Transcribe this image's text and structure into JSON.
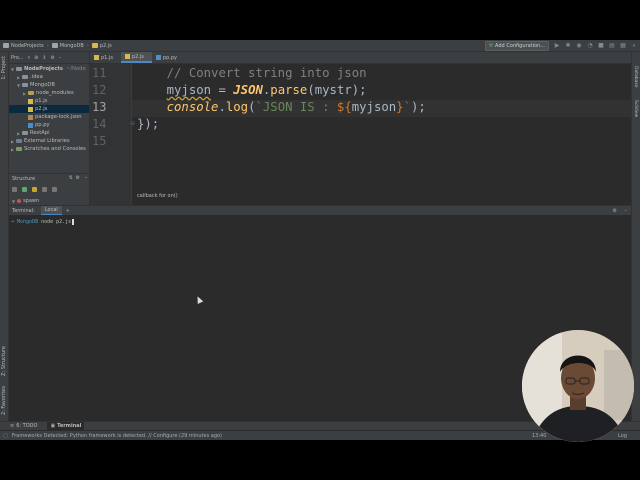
{
  "navbar": {
    "crumbs": [
      "NodeProjects",
      "MongoDB",
      "p2.js"
    ],
    "add_config_label": "Add Configuration..."
  },
  "left_strip": {
    "project_label": "1: Project",
    "structure_label": "Z: Structure",
    "favorites_label": "2: Favorites"
  },
  "right_strip": {
    "database_label": "Database",
    "sciview_label": "SciView"
  },
  "project": {
    "header_label": "Pro...",
    "tree": [
      {
        "label": "NodeProjects",
        "suffix": "~/Node",
        "kind": "folder",
        "depth": 0
      },
      {
        "label": ".idea",
        "kind": "folder",
        "depth": 1
      },
      {
        "label": "MongoDB",
        "kind": "folder",
        "depth": 1
      },
      {
        "label": "node_modules",
        "kind": "folder",
        "depth": 2
      },
      {
        "label": "p1.js",
        "kind": "js",
        "depth": 3
      },
      {
        "label": "p2.js",
        "kind": "js",
        "depth": 3
      },
      {
        "label": "package-lock.json",
        "kind": "json",
        "depth": 3
      },
      {
        "label": "pp.py",
        "kind": "py",
        "depth": 3
      },
      {
        "label": "RestApi",
        "kind": "folder",
        "depth": 1
      },
      {
        "label": "External Libraries",
        "kind": "lib",
        "depth": 0
      },
      {
        "label": "Scratches and Consoles",
        "kind": "scratch",
        "depth": 0
      }
    ]
  },
  "structure": {
    "title": "Structure",
    "item": "spawn"
  },
  "editor": {
    "tabs": [
      {
        "label": "p1.js",
        "kind": "js"
      },
      {
        "label": "p2.js",
        "kind": "js",
        "active": true
      },
      {
        "label": "pp.py",
        "kind": "py"
      }
    ],
    "lines": [
      {
        "num": "11",
        "text": "// Convert string into json"
      },
      {
        "num": "12",
        "text": "myjson = JSON.parse(mystr);"
      },
      {
        "num": "13",
        "text": "console.log(`JSON IS : ${myjson}`);"
      },
      {
        "num": "14",
        "text": "});"
      },
      {
        "num": "15",
        "text": ""
      }
    ],
    "hint": "callback for on()"
  },
  "terminal": {
    "title": "Terminal:",
    "tab": "Local",
    "prompt_dir": "MongoDB",
    "command": "node p2.js"
  },
  "bottom_tabs": [
    "6: TODO",
    "Terminal"
  ],
  "status": {
    "message": "Frameworks Detected: Python framework is detected. // Configure (29 minutes ago)",
    "position": "13:40",
    "encoding": "Log"
  }
}
